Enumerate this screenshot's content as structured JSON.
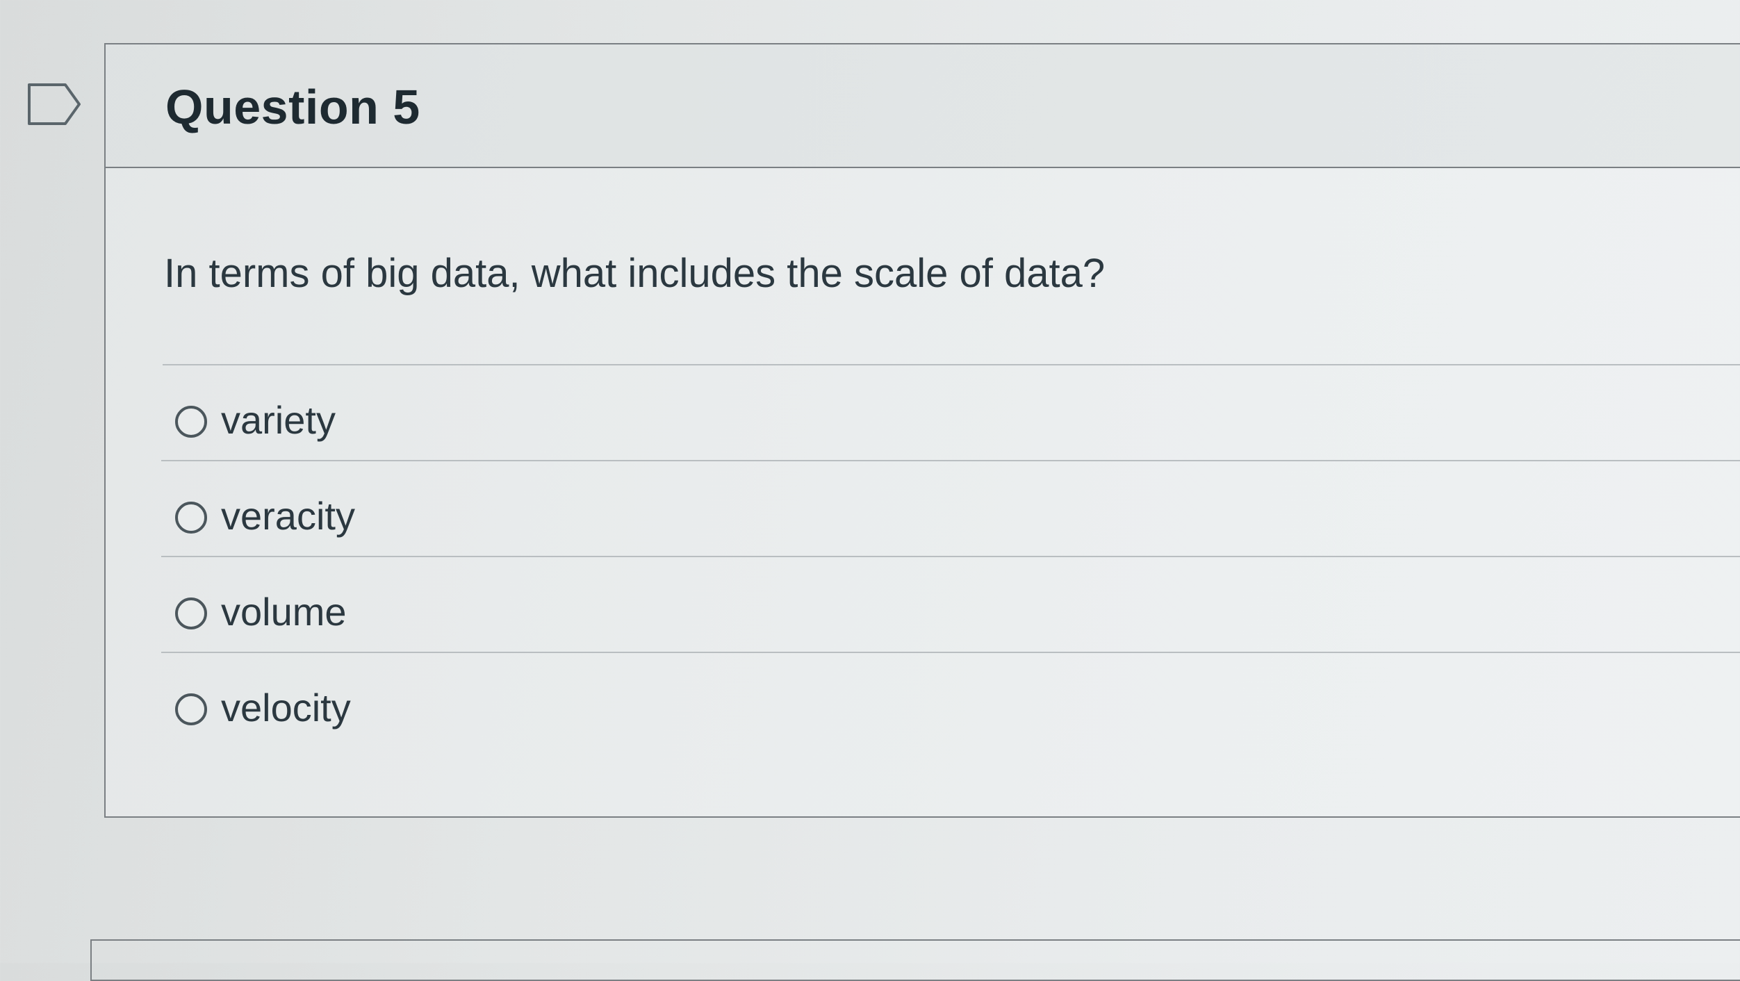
{
  "question": {
    "title": "Question 5",
    "prompt": "In terms of big data, what includes the scale of data?",
    "answers": [
      {
        "label": "variety"
      },
      {
        "label": "veracity"
      },
      {
        "label": "volume"
      },
      {
        "label": "velocity"
      }
    ]
  },
  "icons": {
    "flag": "flag-question-icon",
    "radio": "radio-button-icon"
  },
  "colors": {
    "text": "#2d3b45",
    "border": "#7a7f83",
    "divider": "#b9bec1"
  }
}
